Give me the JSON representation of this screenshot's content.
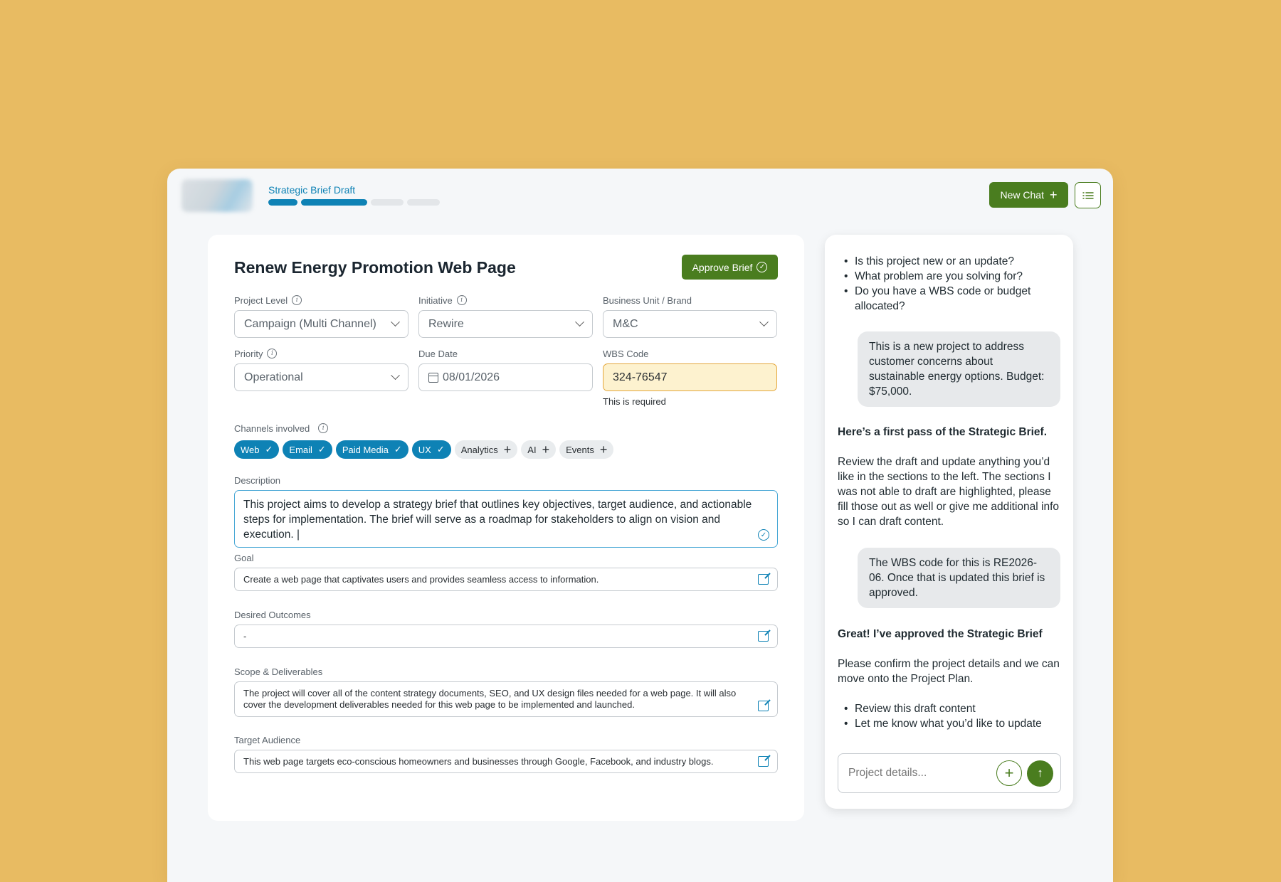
{
  "header": {
    "stepper_label": "Strategic Brief Draft",
    "steps": [
      {
        "state": "complete"
      },
      {
        "state": "complete"
      },
      {
        "state": "pending"
      },
      {
        "state": "pending"
      }
    ],
    "new_chat_label": "New Chat",
    "menu_icon": "list-icon"
  },
  "form": {
    "title": "Renew Energy Promotion Web Page",
    "approve_label": "Approve Brief",
    "project_level": {
      "label": "Project Level",
      "value": "Campaign (Multi Channel)"
    },
    "initiative": {
      "label": "Initiative",
      "value": "Rewire"
    },
    "business_unit": {
      "label": "Business Unit / Brand",
      "value": "M&C"
    },
    "priority": {
      "label": "Priority",
      "value": "Operational"
    },
    "due_date": {
      "label": "Due Date",
      "value": "08/01/2026"
    },
    "wbs": {
      "label": "WBS Code",
      "value": "324-76547",
      "note": "This is required"
    },
    "channels": {
      "label": "Channels involved",
      "items": [
        {
          "label": "Web",
          "selected": true
        },
        {
          "label": "Email",
          "selected": true
        },
        {
          "label": "Paid Media",
          "selected": true
        },
        {
          "label": "UX",
          "selected": true
        },
        {
          "label": "Analytics",
          "selected": false
        },
        {
          "label": "AI",
          "selected": false
        },
        {
          "label": "Events",
          "selected": false
        }
      ]
    },
    "description": {
      "label": "Description",
      "value": "This project aims to develop a  strategy brief that outlines key objectives, target audience, and actionable steps for implementation. The brief will serve as a roadmap for stakeholders to align on vision and execution. |"
    },
    "goal": {
      "label": "Goal",
      "value": "Create a web page that captivates users and provides seamless access to information."
    },
    "outcomes": {
      "label": "Desired Outcomes",
      "value": "-"
    },
    "scope": {
      "label": "Scope & Deliverables",
      "value": "The project will cover all of the content strategy documents, SEO, and UX design files needed for a web page. It will also cover the development deliverables needed for this web page to be implemented and launched."
    },
    "audience": {
      "label": "Target Audience",
      "value": "This web page targets eco-conscious homeowners and businesses through Google, Facebook, and industry blogs."
    }
  },
  "chat": {
    "questions": [
      "Is this project new or an update?",
      "What problem are you solving for?",
      "Do you have a WBS code or budget allocated?"
    ],
    "user_msg_1": "This is a new project to address customer concerns about sustainable energy options. Budget: $75,000.",
    "ai_heading_1": "Here’s a first pass of the Strategic Brief.",
    "ai_text_1": "Review the draft and update anything you’d like in the sections to the left. The sections I was not able to draft are highlighted, please fill those out as well or give me additional info so I can draft content.",
    "user_msg_2": "The WBS code for this is RE2026-06. Once that is updated this brief is approved.",
    "ai_heading_2": "Great! I’ve approved the Strategic Brief",
    "ai_text_2": "Please confirm the project details and we can move onto the Project Plan.",
    "ai_bullets_2": [
      "Review this draft content",
      "Let me know what you’d like to update"
    ],
    "input_placeholder": "Project details..."
  },
  "colors": {
    "background": "#E8BB62",
    "primary_green": "#4a7d1f",
    "accent_blue": "#0e82b5",
    "warning_fill": "#fdf2cf"
  }
}
